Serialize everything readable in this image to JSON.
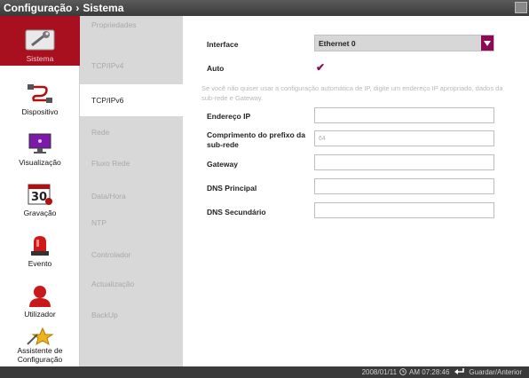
{
  "header": {
    "section": "Configuração",
    "separator": "›",
    "page": "Sistema"
  },
  "sidebar": {
    "items": [
      {
        "label": "Sistema",
        "icon": "wrench-icon"
      },
      {
        "label": "Dispositivo",
        "icon": "cable-plug-icon"
      },
      {
        "label": "Visualização",
        "icon": "monitor-icon"
      },
      {
        "label": "Gravação",
        "icon": "calendar-icon"
      },
      {
        "label": "Evento",
        "icon": "alarm-light-icon"
      },
      {
        "label": "Utilizador",
        "icon": "user-icon"
      },
      {
        "label": "Assistente de Configuração",
        "icon": "wizard-star-icon"
      }
    ]
  },
  "submenu": {
    "items": [
      {
        "label": "Propriedades"
      },
      {
        "label": "TCP/IPv4"
      },
      {
        "label": "TCP/IPv6"
      },
      {
        "label": "Rede"
      },
      {
        "label": "Fluxo Rede"
      },
      {
        "label": "Data/Hora"
      },
      {
        "label": "NTP"
      },
      {
        "label": "Controlador"
      },
      {
        "label": "Actualização"
      },
      {
        "label": "BackUp"
      }
    ],
    "active": "TCP/IPv6"
  },
  "form": {
    "interface_label": "Interface",
    "interface_value": "Ethernet 0",
    "auto_label": "Auto",
    "auto_checked": "✔",
    "note": "Se você não quiser usar a configuração automática de IP, digite um endereço IP apropriado, dados da sub-rede e Gateway.",
    "address_label": "Endereço IP",
    "address_value": "",
    "prefix_label": "Comprimento do prefixo da sub-rede",
    "prefix_value": "64",
    "gateway_label": "Gateway",
    "gateway_value": "",
    "dns_primary_label": "DNS Principal",
    "dns_primary_value": "",
    "dns_secondary_label": "DNS Secundário",
    "dns_secondary_value": ""
  },
  "status": {
    "date": "2008/01/11",
    "time": "AM 07:28:46",
    "save_label": "Guardar/Anterior"
  },
  "colors": {
    "accent": "#a8101f",
    "select_arrow": "#8b0a53",
    "check": "#8b0a53"
  }
}
